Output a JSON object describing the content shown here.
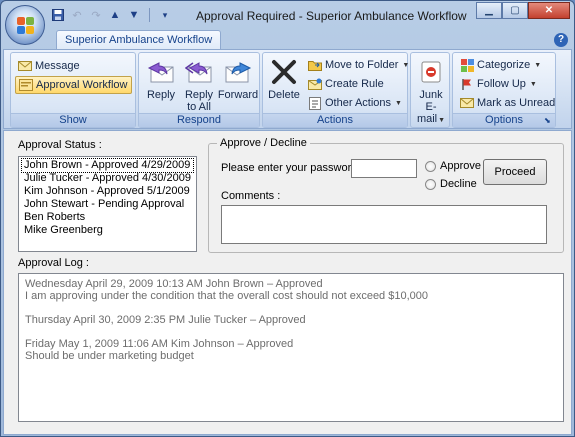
{
  "window": {
    "title": "Approval Required - Superior Ambulance Workflow",
    "controls": [
      "minimize",
      "maximize",
      "close"
    ]
  },
  "quick_access": [
    "save-icon",
    "undo-icon",
    "redo-icon",
    "up-icon",
    "down-icon",
    "customize-icon"
  ],
  "ribbon": {
    "tab": "Superior Ambulance Workflow",
    "groups": {
      "show": {
        "label": "Show",
        "message": "Message",
        "approval_workflow": "Approval Workflow"
      },
      "respond": {
        "label": "Respond",
        "reply": "Reply",
        "reply_all_line1": "Reply",
        "reply_all_line2": "to All",
        "forward": "Forward"
      },
      "actions": {
        "label": "Actions",
        "delete": "Delete",
        "move_to_folder": "Move to Folder",
        "create_rule": "Create Rule",
        "other_actions": "Other Actions"
      },
      "junk": {
        "line1": "Junk",
        "line2": "E-mail"
      },
      "options": {
        "label": "Options",
        "categorize": "Categorize",
        "follow_up": "Follow Up",
        "mark_unread": "Mark as Unread"
      }
    }
  },
  "approval_status": {
    "label": "Approval Status :",
    "items": [
      "John Brown - Approved 4/29/2009",
      "Julie Tucker - Approved 4/30/2009",
      "Kim Johnson - Approved 5/1/2009",
      "John Stewart - Pending Approval",
      "Ben Roberts",
      "Mike Greenberg"
    ]
  },
  "approve_decline": {
    "legend": "Approve / Decline",
    "password_label": "Please enter your password :",
    "approve": "Approve",
    "decline": "Decline",
    "proceed": "Proceed",
    "comments_label": "Comments :"
  },
  "approval_log": {
    "label": "Approval Log :",
    "entries": [
      {
        "header": "Wednesday April 29, 2009 10:13 AM  John Brown – Approved",
        "body": "I am approving under the condition that the overall cost should not exceed $10,000"
      },
      {
        "header": "Thursday April 30, 2009 2:35 PM  Julie Tucker – Approved",
        "body": ""
      },
      {
        "header": "Friday May 1, 2009 11:06 AM  Kim Johnson – Approved",
        "body": "Should be under marketing budget"
      }
    ]
  }
}
